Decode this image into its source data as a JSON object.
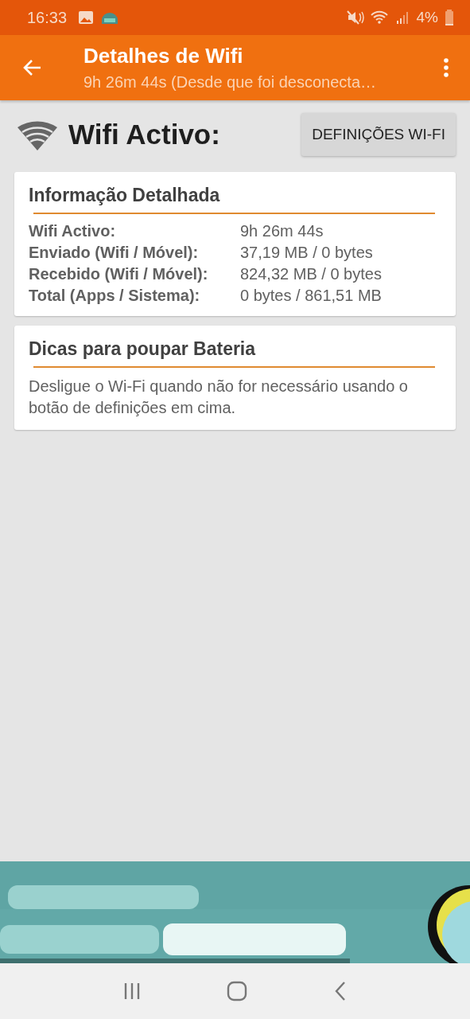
{
  "status_bar": {
    "time": "16:33",
    "battery": "4%"
  },
  "app_bar": {
    "title": "Detalhes de Wifi",
    "subtitle": "9h 26m 44s (Desde que foi desconecta…"
  },
  "header": {
    "title": "Wifi Activo:",
    "button": "DEFINIÇÕES WI-FI"
  },
  "cards": [
    {
      "kind": "table",
      "title": "Informação Detalhada",
      "rows": [
        {
          "label": "Wifi Activo:",
          "value": "9h 26m 44s"
        },
        {
          "label": "Enviado (Wifi / Móvel):",
          "value": "37,19 MB / 0 bytes"
        },
        {
          "label": "Recebido (Wifi / Móvel):",
          "value": "824,32 MB / 0 bytes"
        },
        {
          "label": "Total (Apps / Sistema):",
          "value": "0 bytes / 861,51 MB"
        }
      ]
    },
    {
      "kind": "text",
      "title": "Dicas para poupar Bateria",
      "text": "Desligue o Wi-Fi quando não for necessário usando o botão de definições em cima."
    }
  ]
}
